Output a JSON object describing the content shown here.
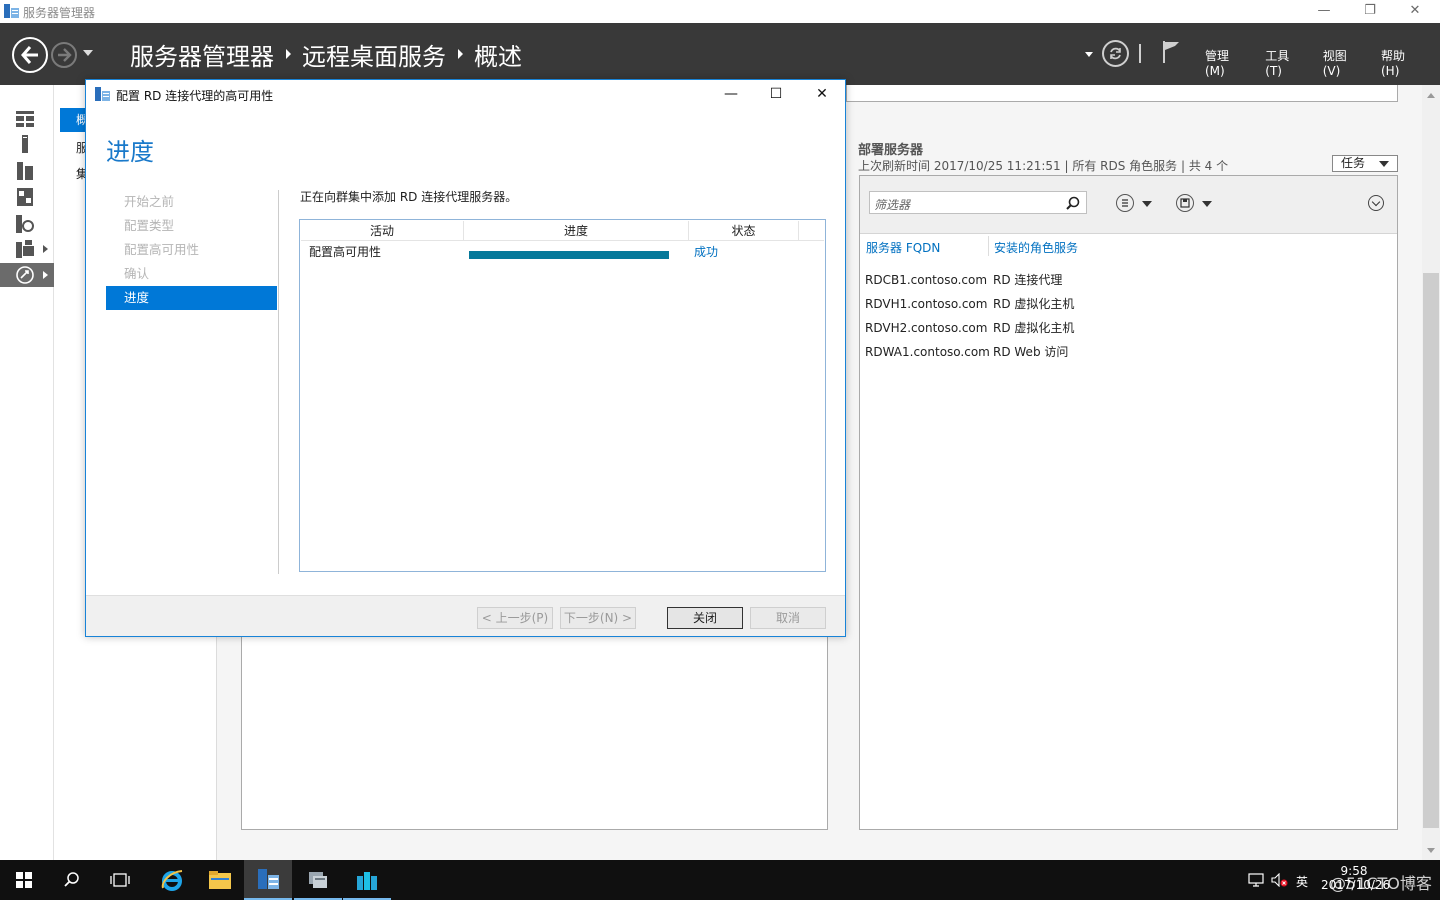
{
  "window": {
    "title": "服务器管理器",
    "min": "—",
    "restore": "❐",
    "close": "✕"
  },
  "header": {
    "breadcrumb": [
      "服务器管理器",
      "远程桌面服务",
      "概述"
    ],
    "menus": [
      "管理(M)",
      "工具(T)",
      "视图(V)",
      "帮助(H)"
    ]
  },
  "subnav": {
    "selected": "概",
    "items": [
      "服",
      "集"
    ]
  },
  "servers": {
    "title": "部署服务器",
    "subtitle": "上次刷新时间 2017/10/25 11:21:51 | 所有 RDS 角色服务  | 共 4 个",
    "task_button": "任务",
    "filter_placeholder": "筛选器",
    "columns": [
      "服务器 FQDN",
      "安装的角色服务"
    ],
    "rows": [
      [
        "RDCB1.contoso.com",
        "RD 连接代理"
      ],
      [
        "RDVH1.contoso.com",
        "RD 虚拟化主机"
      ],
      [
        "RDVH2.contoso.com",
        "RD 虚拟化主机"
      ],
      [
        "RDWA1.contoso.com",
        "RD Web 访问"
      ]
    ]
  },
  "dialog": {
    "title": "配置 RD 连接代理的高可用性",
    "heading": "进度",
    "steps": [
      "开始之前",
      "配置类型",
      "配置高可用性",
      "确认",
      "进度"
    ],
    "active_step": 4,
    "description": "正在向群集中添加 RD 连接代理服务器。",
    "grid": {
      "columns": [
        "活动",
        "进度",
        "状态"
      ],
      "rows": [
        {
          "activity": "配置高可用性",
          "progress": 1.0,
          "status": "成功"
        }
      ]
    },
    "buttons": {
      "prev": "< 上一步(P)",
      "next": "下一步(N) >",
      "close": "关闭",
      "cancel": "取消"
    },
    "controls": {
      "min": "—",
      "max": "☐",
      "close": "✕"
    }
  },
  "taskbar": {
    "ime": "英",
    "time": "9:58",
    "date": "2017/10/26",
    "watermark": "@51CTO博客"
  },
  "colors": {
    "accent": "#0078d7",
    "header_bg": "#393939",
    "progress": "#06799a",
    "link": "#0070c0"
  }
}
